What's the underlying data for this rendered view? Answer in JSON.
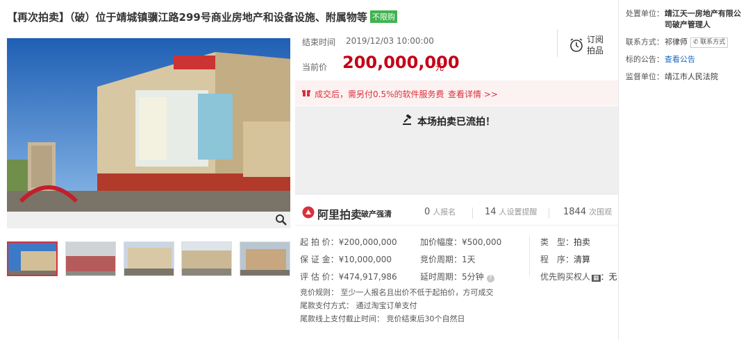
{
  "title": {
    "text": "【再次拍卖】（破）位于靖城镇骥江路299号商业房地产和设备设施、附属物等",
    "badge": "不限购"
  },
  "auction": {
    "end_label": "结束时间",
    "end_time": "2019/12/03 10:00:00",
    "price_label": "当前价",
    "price": "200,000,000",
    "price_unit": "元",
    "subscribe_label": "订阅拍品",
    "fee_text": "成交后，需另付0.5%的软件服务费",
    "fee_detail": "查看详情 >>",
    "status": "本场拍卖已流拍！"
  },
  "stats": {
    "brand": "阿里拍卖",
    "brand_sub": "破产强清",
    "signups": "0",
    "signups_unit": "人报名",
    "reminders": "14",
    "reminders_unit": "人设置提醒",
    "views": "1844",
    "views_unit": "次围观"
  },
  "params": {
    "start_price_label": "起 拍 价：",
    "start_price": "¥200,000,000",
    "deposit_label": "保 证 金：",
    "deposit": "¥10,000,000",
    "valuation_label": "评 估 价：",
    "valuation": "¥474,917,986",
    "increment_label": "加价幅度：",
    "increment": "¥500,000",
    "cycle_label": "竞价周期：",
    "cycle": "1天",
    "delay_label": "延时周期：",
    "delay": "5分钟",
    "type_label": "类　型：",
    "type": "拍卖",
    "procedure_label": "程　序：",
    "procedure": "清算",
    "priority_label": "优先购买权人",
    "priority_value": "：无"
  },
  "rules": {
    "bid_rule": "竞价规则： 至少一人报名且出价不低于起拍价，方可成交",
    "payment_method": "尾款支付方式： 通过淘宝订单支付",
    "payment_deadline": "尾款线上支付截止时间： 竞价结束后30个自然日"
  },
  "side": {
    "org_label": "处置单位：",
    "org": "靖江天一房地产有限公司破产管理人",
    "contact_label": "联系方式：",
    "contact": "祁律师",
    "contact_btn": "联系方式",
    "notice_label": "标的公告：",
    "notice": "查看公告",
    "supervisor_label": "监督单位：",
    "supervisor": "靖江市人民法院"
  },
  "colors": {
    "price_red": "#c40016",
    "badge_green": "#3fb34f",
    "link_blue": "#1a66c1"
  }
}
